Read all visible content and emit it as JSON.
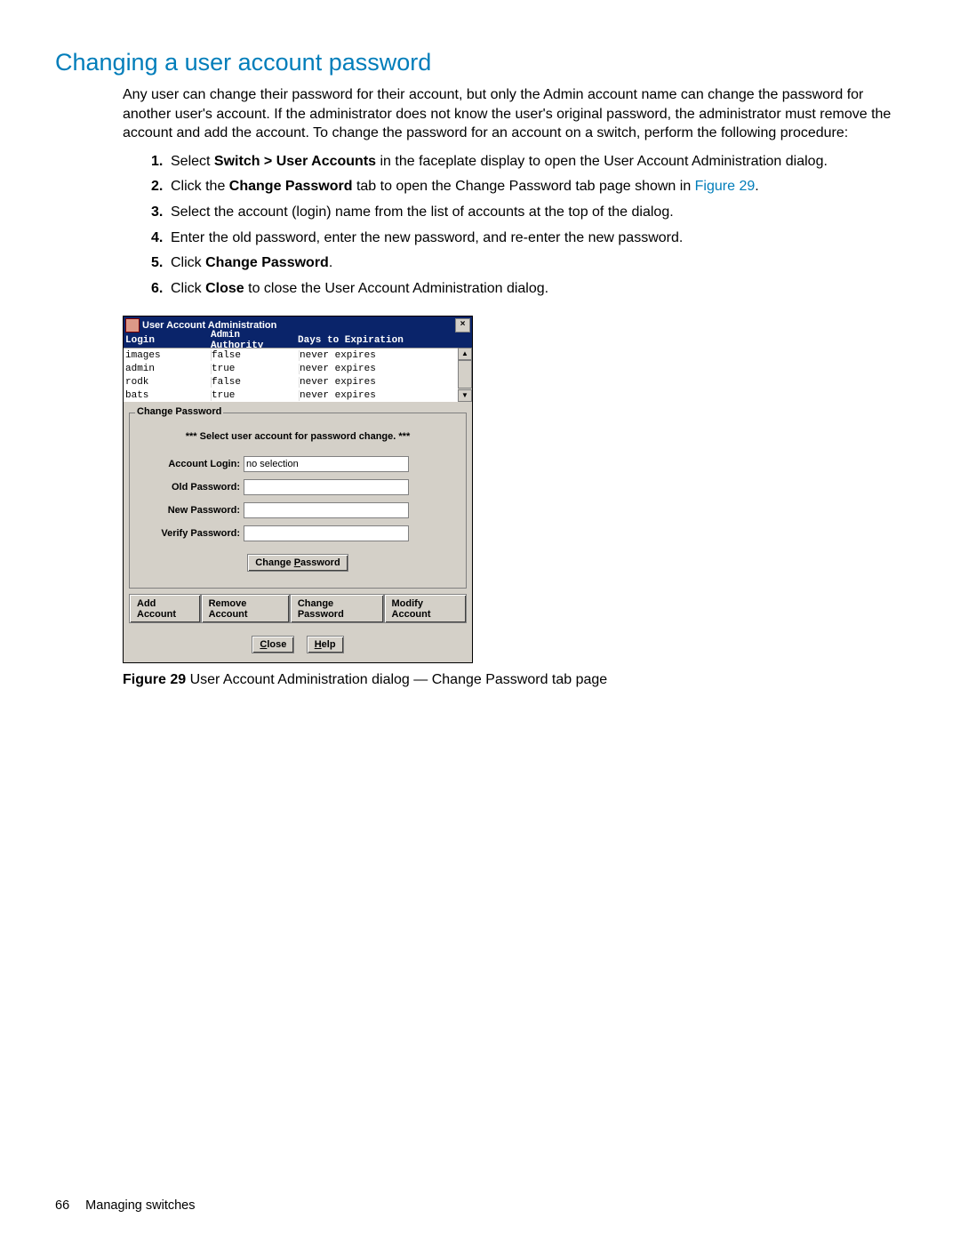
{
  "heading": "Changing a user account password",
  "intro_para": "Any user can change their password for their account, but only the Admin account name can change the password for another user's account. If the administrator does not know the user's original password, the administrator must remove the account and add the account. To change the password for an account on a switch, perform the following procedure:",
  "steps": {
    "s1_a": "Select ",
    "s1_b_bold": "Switch > User Accounts",
    "s1_c": " in the faceplate display to open the User Account Administration dialog.",
    "s2_a": "Click the ",
    "s2_b_bold": "Change Password",
    "s2_c": " tab to open the Change Password tab page shown in ",
    "s2_link": "Figure 29",
    "s2_d": ".",
    "s3": "Select the account (login) name from the list of accounts at the top of the dialog.",
    "s4": "Enter the old password, enter the new password, and re-enter the new password.",
    "s5_a": "Click ",
    "s5_b_bold": "Change Password",
    "s5_c": ".",
    "s6_a": "Click ",
    "s6_b_bold": "Close",
    "s6_c": " to close the User Account Administration dialog."
  },
  "dialog": {
    "title": "User Account Administration",
    "columns": {
      "login": "Login",
      "admin": "Admin Authority",
      "days": "Days to Expiration"
    },
    "rows": [
      {
        "login": "images",
        "admin": "false",
        "days": "never expires"
      },
      {
        "login": "admin",
        "admin": "true",
        "days": "never expires"
      },
      {
        "login": "rodk",
        "admin": "false",
        "days": "never expires"
      },
      {
        "login": "bats",
        "admin": "true",
        "days": "never expires"
      }
    ],
    "group_title": "Change Password",
    "select_msg": "*** Select user account for password change. ***",
    "labels": {
      "account_login": "Account Login:",
      "old_password": "Old Password:",
      "new_password": "New Password:",
      "verify_password": "Verify Password:"
    },
    "values": {
      "account_login": "no selection",
      "old_password": "",
      "new_password": "",
      "verify_password": ""
    },
    "change_password_btn_prefix": "Change ",
    "change_password_btn_u": "P",
    "change_password_btn_suffix": "assword",
    "tabs": {
      "add": "Add Account",
      "remove": "Remove Account",
      "change": "Change Password",
      "modify": "Modify Account"
    },
    "close_btn_u": "C",
    "close_btn_rest": "lose",
    "help_btn_u": "H",
    "help_btn_rest": "elp"
  },
  "figure": {
    "label": "Figure 29",
    "caption": " User Account Administration dialog — Change Password tab page"
  },
  "footer": {
    "page_number": "66",
    "chapter": "Managing switches"
  }
}
